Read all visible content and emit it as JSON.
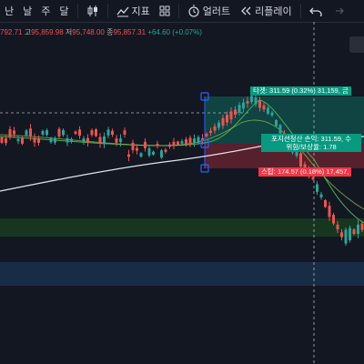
{
  "toolbar": {
    "timeframes": [
      "난",
      "날",
      "주",
      "달"
    ],
    "indicators_label": "지표",
    "alert_label": "얼러트",
    "replay_label": "리플레이"
  },
  "ohlc": {
    "open": "792.71",
    "high_key": "고",
    "high": "95,859.98",
    "low_key": "저",
    "low": "95,748.00",
    "close_key": "종",
    "close": "95,857.31",
    "change": "+64.60 (+0.07%)"
  },
  "position": {
    "target_label": "타겟: 311.59 (0.32%) 31,159, 금",
    "pnl_label": "포지션청산 손익: 311.59, 수",
    "risk_reward_label": "위험/보상율: 1.78",
    "stop_label": "스탑: 174.57 (0.18%) 17,457,"
  },
  "colors": {
    "background": "#131722",
    "up": "#26a69a",
    "down": "#ef5350",
    "target_zone": "#089981",
    "stop_zone": "#f23645",
    "ma_long": "#e0e3eb",
    "ma_fast": "#4caf50",
    "ma_slow": "#8bc34a",
    "support_zone": "#1b5e20",
    "demand_zone": "#1e3a5f"
  }
}
